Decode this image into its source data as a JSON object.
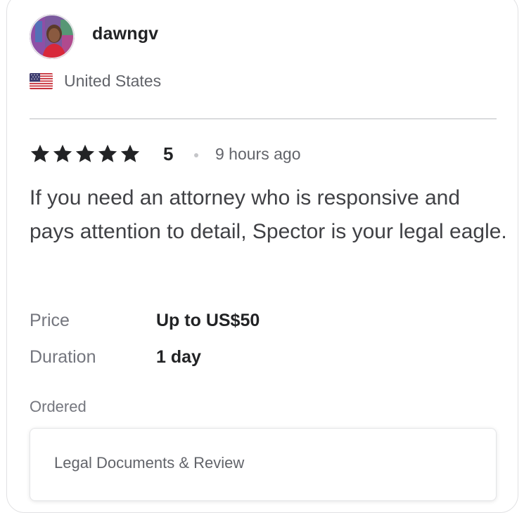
{
  "reviewer": {
    "username": "dawngv",
    "country": "United States",
    "flag_icon": "us-flag-icon",
    "avatar_icon": "avatar-photo"
  },
  "review": {
    "stars": 5,
    "rating": "5",
    "time": "9 hours ago",
    "text": "If you need an attorney who is responsive and pays attention to detail, Spector is your legal eagle."
  },
  "details": {
    "price_label": "Price",
    "price_value": "Up to US$50",
    "duration_label": "Duration",
    "duration_value": "1 day"
  },
  "ordered": {
    "label": "Ordered",
    "item": "Legal Documents & Review"
  },
  "colors": {
    "star": "#222325",
    "text_primary": "#222325",
    "text_secondary": "#62646a",
    "divider": "#dadbdd"
  }
}
